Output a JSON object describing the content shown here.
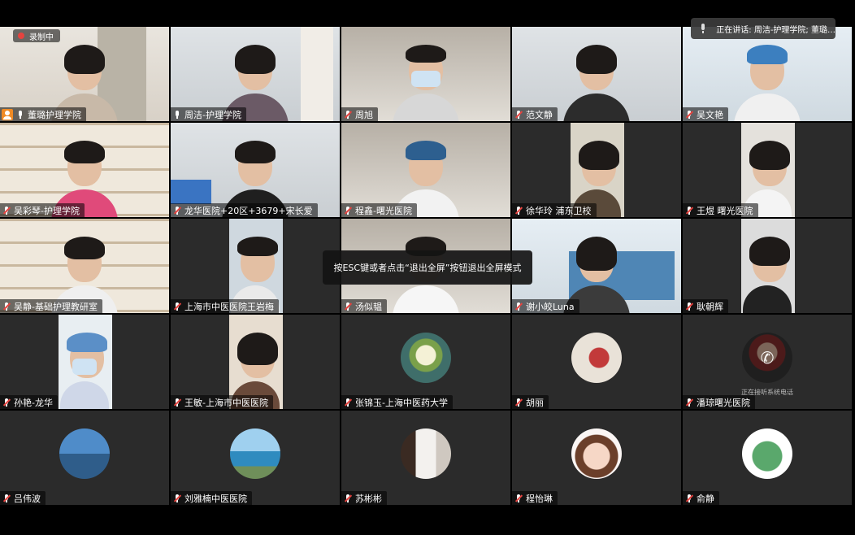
{
  "recording": {
    "label": "录制中"
  },
  "speaking": {
    "text": "正在讲话: 周洁-护理学院; 董璐…"
  },
  "toast": {
    "text": "按ESC键或者点击“退出全屏”按钮退出全屏模式"
  },
  "colors": {
    "active_border": "#4fc35a",
    "recording_dot": "#e5433f",
    "host_badge": "#f08a24"
  },
  "participants": [
    {
      "name": "董璐护理学院",
      "host": true,
      "muted": false
    },
    {
      "name": "周洁-护理学院",
      "active": true,
      "muted": false
    },
    {
      "name": "周旭",
      "muted": true
    },
    {
      "name": "范文静",
      "muted": true
    },
    {
      "name": "吴文艳",
      "muted": true
    },
    {
      "name": "吴彩琴-护理学院",
      "muted": true
    },
    {
      "name": "龙华医院+20区+3679+宋长爱",
      "muted": true
    },
    {
      "name": "程鑫-曙光医院",
      "muted": true
    },
    {
      "name": "徐华玲 浦东卫校",
      "muted": true
    },
    {
      "name": "王煜 曙光医院",
      "muted": true
    },
    {
      "name": "吴静-基础护理教研室",
      "muted": true
    },
    {
      "name": "上海市中医医院王岩梅",
      "muted": true
    },
    {
      "name": "汤似韫",
      "muted": true
    },
    {
      "name": "谢小皎Luna",
      "muted": true
    },
    {
      "name": "耿朝辉",
      "muted": true
    },
    {
      "name": "孙艳-龙华",
      "muted": true
    },
    {
      "name": "王敏-上海市中医医院",
      "muted": true
    },
    {
      "name": "张锦玉-上海中医药大学",
      "muted": true
    },
    {
      "name": "胡丽",
      "muted": true
    },
    {
      "name": "潘琼曙光医院",
      "muted": true,
      "status": "正在接听系统电话"
    },
    {
      "name": "吕伟波",
      "muted": true
    },
    {
      "name": "刘雅楠中医医院",
      "muted": true
    },
    {
      "name": "苏彬彬",
      "muted": true
    },
    {
      "name": "程怡琳",
      "muted": true
    },
    {
      "name": "俞静",
      "muted": true
    }
  ]
}
